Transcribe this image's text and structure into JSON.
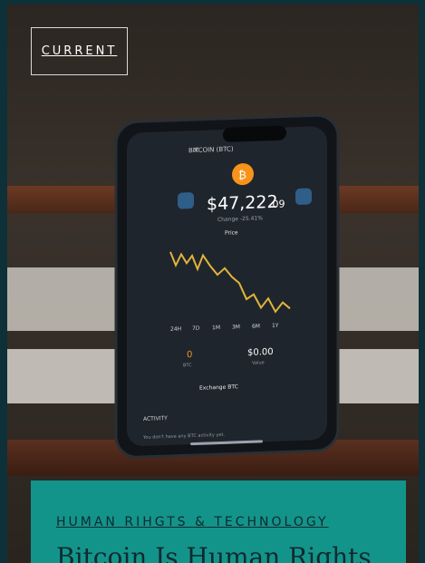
{
  "badge": {
    "label": "CURRENT"
  },
  "phone": {
    "header": "BITCOIN (BTC)",
    "price_main": "$47,222",
    "price_cents": ".09",
    "change": "Change -25.41%",
    "tab_price": "Price",
    "ranges": [
      "24H",
      "7D",
      "1M",
      "3M",
      "6M",
      "1Y"
    ],
    "btc_amount": "0",
    "btc_label": "BTC",
    "value_amount": "$0.00",
    "value_label": "Value",
    "exchange_label": "Exchange BTC",
    "activity_label": "ACTIVITY",
    "activity_empty": "You don't have any BTC activity yet."
  },
  "card": {
    "category": "HUMAN RIHGTS & TECHNOLOGY",
    "title": "Bitcoin Is Human Rights"
  },
  "colors": {
    "teal_card": "#13948a",
    "bitcoin_orange": "#f7931a",
    "chart_line": "#e0b43a",
    "frame": "#0e3038"
  }
}
